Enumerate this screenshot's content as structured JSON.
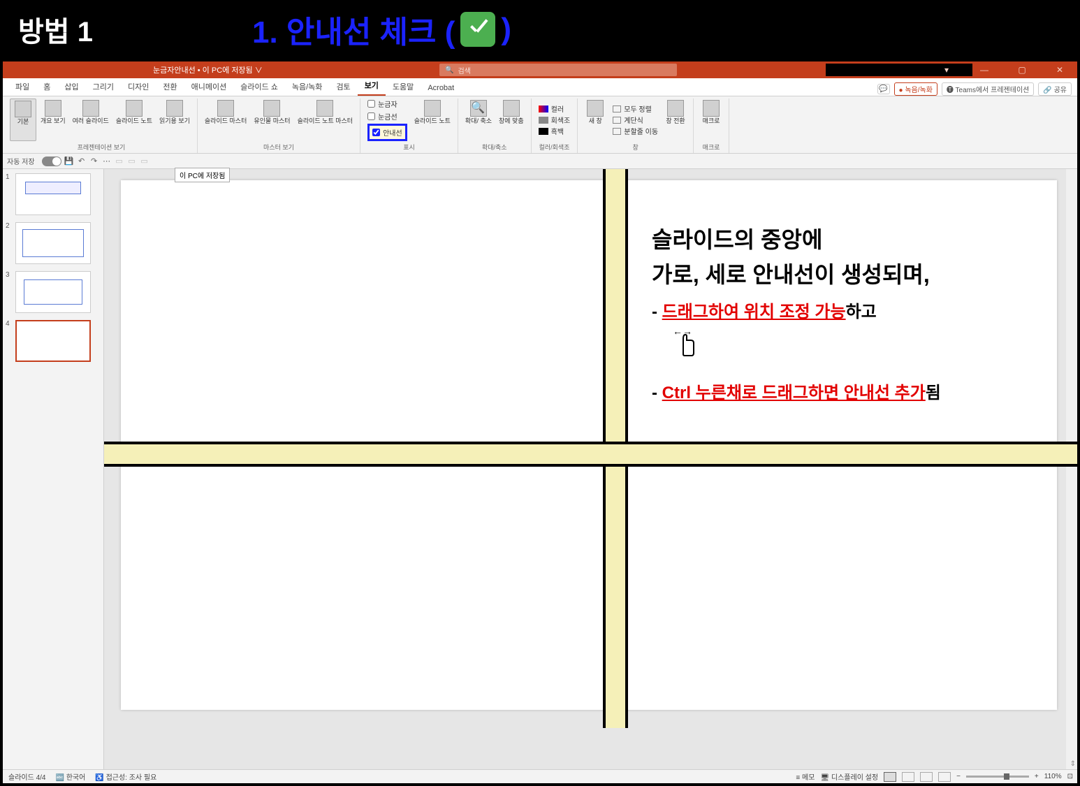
{
  "annotation": {
    "method_label": "방법 1",
    "title_prefix": "1. 안내선 체크 ( ",
    "title_suffix": " )"
  },
  "titlebar": {
    "doc_title": "눈금자안내선 • 이 PC에 저장됨 ∨",
    "search_placeholder": "검색",
    "win_minimize": "—",
    "win_maximize": "▢",
    "win_close": "✕",
    "ribbon_mode": "▾"
  },
  "menubar": {
    "tabs": [
      "파일",
      "홈",
      "삽입",
      "그리기",
      "디자인",
      "전환",
      "애니메이션",
      "슬라이드 쇼",
      "녹음/녹화",
      "검토",
      "보기",
      "도움말",
      "Acrobat"
    ],
    "active_index": 10,
    "comment_btn": "💬",
    "record_btn": "● 녹음/녹화",
    "teams_btn": "🅣 Teams에서 프레젠테이션",
    "share_btn": "🔗 공유"
  },
  "ribbon": {
    "groups": {
      "presentation_views": {
        "label": "프레젠테이션 보기",
        "tools": [
          {
            "label": "기본"
          },
          {
            "label": "개요\n보기"
          },
          {
            "label": "여러\n슬라이드"
          },
          {
            "label": "슬라이드\n노트"
          },
          {
            "label": "읽기용\n보기"
          }
        ]
      },
      "master_views": {
        "label": "마스터 보기",
        "tools": [
          {
            "label": "슬라이드\n마스터"
          },
          {
            "label": "유인물\n마스터"
          },
          {
            "label": "슬라이드 노트\n마스터"
          }
        ]
      },
      "show": {
        "label": "표시",
        "checkboxes": [
          {
            "label": "눈금자",
            "checked": false
          },
          {
            "label": "눈금선",
            "checked": false
          },
          {
            "label": "안내선",
            "checked": true,
            "highlighted": true
          }
        ],
        "side_tool": "슬라이드\n노트"
      },
      "zoom": {
        "label": "확대/축소",
        "tools": [
          {
            "label": "확대/\n축소"
          },
          {
            "label": "창에\n맞춤"
          }
        ]
      },
      "color": {
        "label": "컬러/회색조",
        "tools": [
          {
            "label": "컬러",
            "accent": true
          },
          {
            "label": "회색조"
          },
          {
            "label": "흑백"
          }
        ]
      },
      "window": {
        "label": "창",
        "tools": [
          {
            "label": "새 창"
          },
          {
            "label": "모두 정렬"
          },
          {
            "label": "계단식"
          },
          {
            "label": "분할줄 이동"
          },
          {
            "label": "창 전환"
          }
        ]
      },
      "macro": {
        "label": "매크로",
        "tools": [
          {
            "label": "매크로"
          }
        ]
      }
    }
  },
  "qat": {
    "autosave_label": "자동 저장",
    "tooltip": "이 PC에 저장됨"
  },
  "thumbnails": {
    "items": [
      {
        "num": "1"
      },
      {
        "num": "2"
      },
      {
        "num": "3"
      },
      {
        "num": "4",
        "selected": true
      }
    ]
  },
  "slide_content": {
    "line1": "슬라이드의 중앙에",
    "line2": "가로, 세로 안내선이 생성되며,",
    "line3_prefix": "- ",
    "line3_red": "드래그하여 위치 조정 가능",
    "line3_suffix": "하고",
    "drag_icon": "👆",
    "line4_prefix": "- ",
    "line4_red": "Ctrl 누른채로 드래그하면 안내선 추가",
    "line4_suffix": "됨"
  },
  "statusbar": {
    "slide_info": "슬라이드 4/4",
    "lang": "한국어",
    "accessibility": "접근성: 조사 필요",
    "memo_btn": "메모",
    "display_btn": "디스플레이 설정",
    "zoom_pct": "110%",
    "zoom_fit": "⊡"
  }
}
